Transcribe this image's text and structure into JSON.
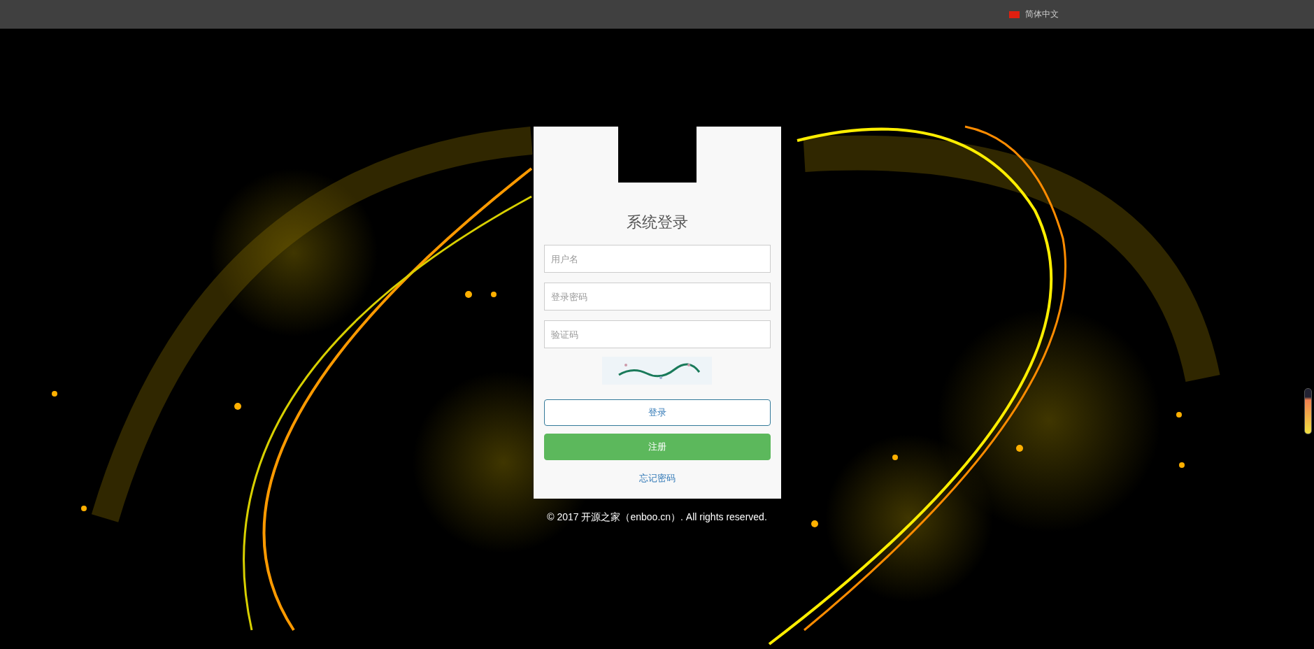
{
  "top_bar": {
    "language": "简体中文"
  },
  "login": {
    "title": "系统登录",
    "fields": [
      {
        "placeholder": "用户名"
      },
      {
        "placeholder": "登录密码"
      },
      {
        "placeholder": "验证码"
      }
    ],
    "buttons": [
      {
        "label": "登录",
        "kind": "outline"
      },
      {
        "label": "注册",
        "kind": "primary"
      }
    ],
    "forgot_link": "忘记密码"
  },
  "footer": "© 2017 开源之家（enboo.cn）. All rights reserved."
}
